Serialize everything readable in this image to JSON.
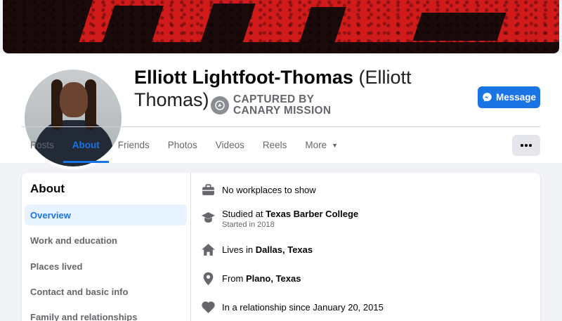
{
  "profile": {
    "name": "Elliott Lightfoot-Thomas",
    "alt_name": "(Elliott Thomas)",
    "captured_label_1": "CAPTURED BY",
    "captured_label_2": "CANARY MISSION",
    "message_label": "Message"
  },
  "tabs": [
    {
      "label": "Posts"
    },
    {
      "label": "About",
      "active": true
    },
    {
      "label": "Friends"
    },
    {
      "label": "Photos"
    },
    {
      "label": "Videos"
    },
    {
      "label": "Reels"
    },
    {
      "label": "More"
    }
  ],
  "about": {
    "title": "About",
    "sidebar": [
      {
        "label": "Overview",
        "active": true
      },
      {
        "label": "Work and education"
      },
      {
        "label": "Places lived"
      },
      {
        "label": "Contact and basic info"
      },
      {
        "label": "Family and relationships"
      }
    ],
    "rows": {
      "work": {
        "text": "No workplaces to show",
        "icon": "briefcase-icon"
      },
      "education": {
        "prefix": "Studied at ",
        "value": "Texas Barber College",
        "sub": "Started in 2018",
        "icon": "graduation-cap-icon"
      },
      "lives": {
        "prefix": "Lives in ",
        "value": "Dallas, Texas",
        "icon": "home-icon"
      },
      "from": {
        "prefix": "From ",
        "value": "Plano, Texas",
        "icon": "location-pin-icon"
      },
      "relationship": {
        "text": "In a relationship since January 20, 2015",
        "icon": "heart-icon"
      }
    }
  },
  "colors": {
    "accent": "#1b74e4",
    "page_bg": "#f0f2f5",
    "muted_text": "#65676b"
  }
}
